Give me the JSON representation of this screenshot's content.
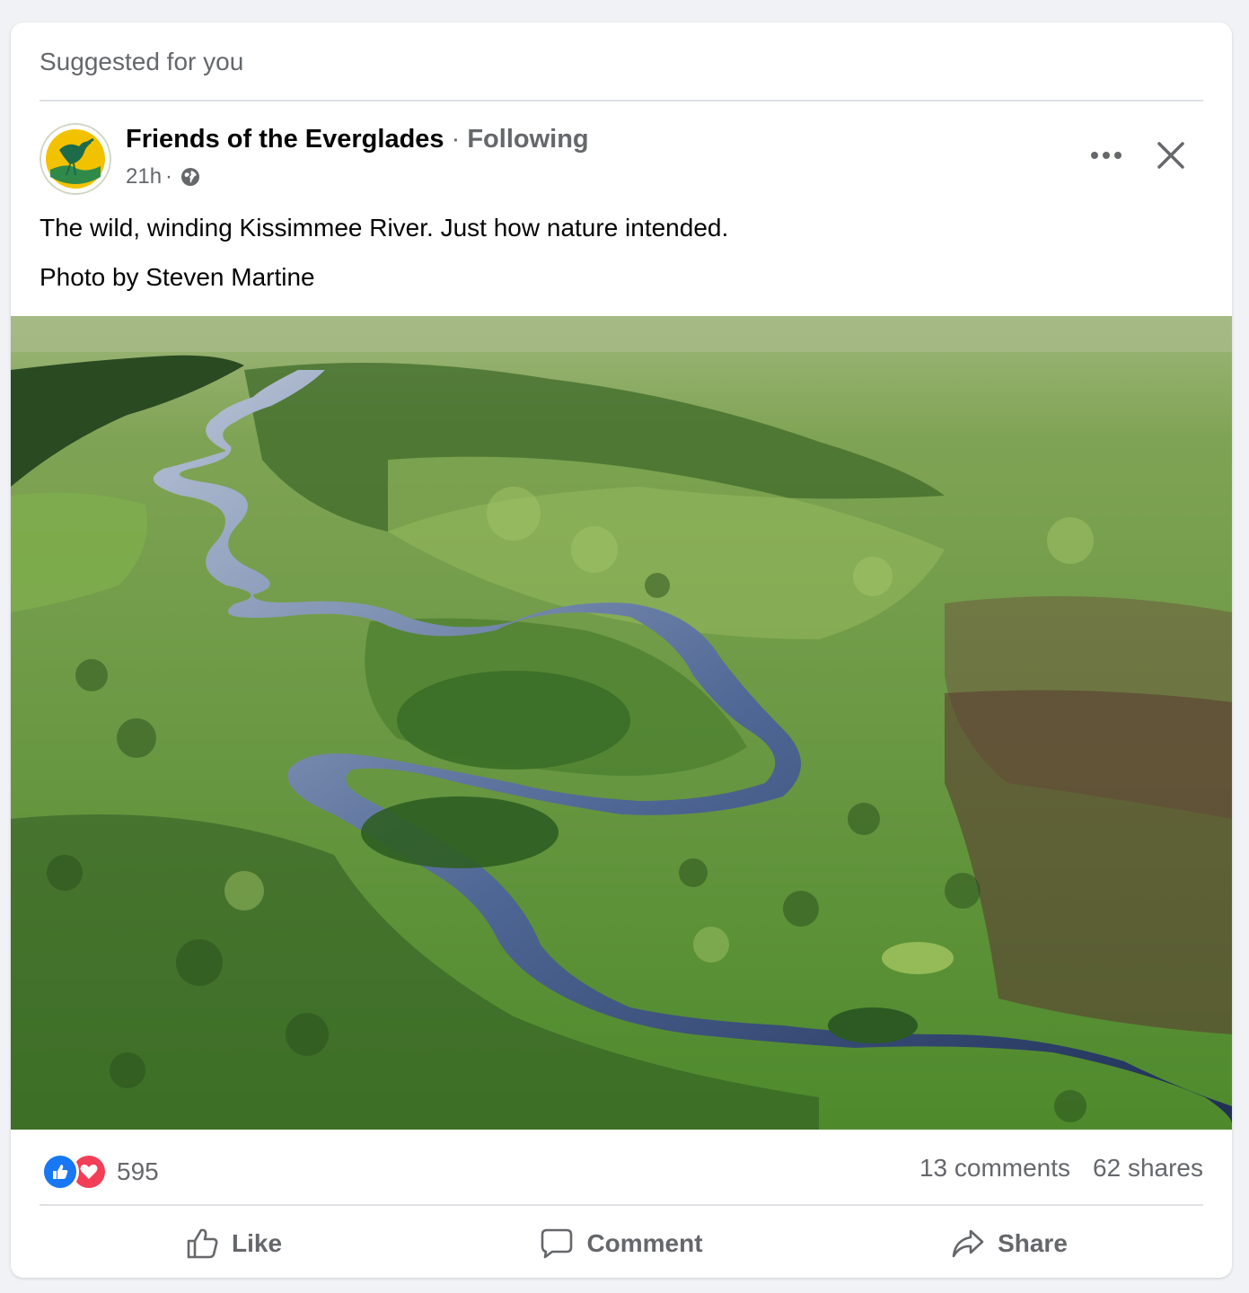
{
  "header": {
    "suggested_label": "Suggested for you"
  },
  "post": {
    "page_name": "Friends of the Everglades",
    "separator": " · ",
    "follow_status": "Following",
    "time": "21h",
    "time_separator": "·",
    "privacy_icon": "globe-icon",
    "text_lines": [
      "The wild, winding Kissimmee River. Just how nature intended.",
      "Photo by Steven Martine"
    ],
    "image_alt": "Aerial view of a winding river through green wetlands"
  },
  "reactions": {
    "icons": [
      "like-icon",
      "love-icon"
    ],
    "count": "595",
    "comments": "13 comments",
    "shares": "62 shares"
  },
  "actions": {
    "like_label": "Like",
    "comment_label": "Comment",
    "share_label": "Share"
  },
  "colors": {
    "accent": "#1877f2",
    "love": "#f33e58",
    "muted_text": "#65676b",
    "avatar_ring": "#f2c200",
    "avatar_bird": "#1e6b4a"
  }
}
